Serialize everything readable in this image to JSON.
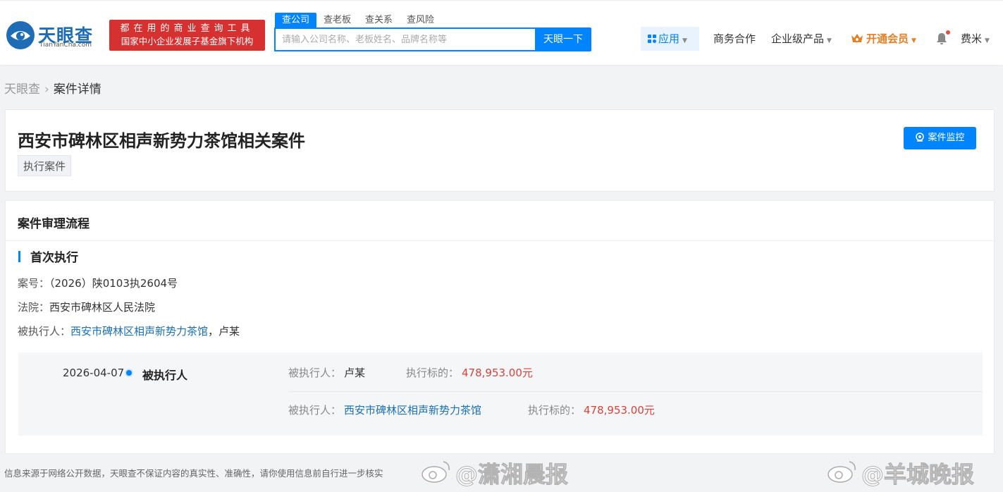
{
  "header": {
    "logo_cn": "天眼查",
    "logo_en": "TianYanCha.com",
    "slogan_line1": "都在用的商业查询工具",
    "slogan_line2": "国家中小企业发展子基金旗下机构",
    "search_tabs": [
      "查公司",
      "查老板",
      "查关系",
      "查风险"
    ],
    "search_placeholder": "请输入公司名称、老板姓名、品牌名称等",
    "search_button": "天眼一下",
    "nav_app": "应用",
    "nav_business": "商务合作",
    "nav_enterprise": "企业级产品",
    "nav_vip": "开通会员",
    "user_name": "费米"
  },
  "breadcrumb": {
    "home": "天眼查",
    "current": "案件详情"
  },
  "case": {
    "title": "西安市碑林区相声新势力茶馆相关案件",
    "tag": "执行案件",
    "monitor_button": "案件监控"
  },
  "process": {
    "section_title": "案件审理流程",
    "stage_title": "首次执行",
    "case_no_label": "案号：",
    "case_no": "（2026）陕0103执2604号",
    "court_label": "法院：",
    "court": "西安市碑林区人民法院",
    "executed_label": "被执行人：",
    "executed_company": "西安市碑林区相声新势力茶馆",
    "executed_sep": "，",
    "executed_person": "卢某",
    "timeline": {
      "date": "2026-04-07",
      "role": "被执行人",
      "rows": [
        {
          "party_label": "被执行人：",
          "party": "卢某",
          "amount_label": "执行标的：",
          "amount": "478,953.00元"
        },
        {
          "party_label": "被执行人：",
          "party": "西安市碑林区相声新势力茶馆",
          "amount_label": "执行标的：",
          "amount": "478,953.00元"
        }
      ]
    }
  },
  "footer": {
    "note": "信息来源于网络公开数据，天眼查不保证内容的真实性、准确性，请你使用信息前自行进一步核实",
    "watermark1": "@潇湘晨报",
    "watermark2": "@羊城晚报"
  },
  "colors": {
    "brand_blue": "#0084ff",
    "slogan_red": "#d63031",
    "amount_red": "#d9413b",
    "vip_orange": "#e67e22"
  }
}
